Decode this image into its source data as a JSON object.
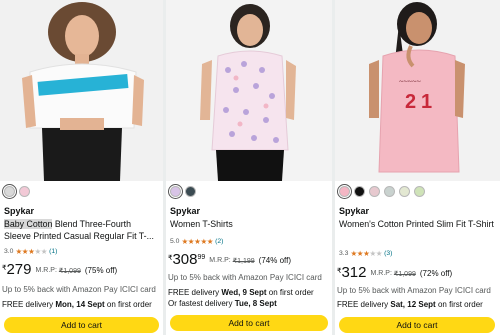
{
  "products": [
    {
      "swatches": [
        "#d9d9d9",
        "#f2c9d6"
      ],
      "brand": "Spykar",
      "title_highlight": "Baby Cotton",
      "title_rest": " Blend Three-Fourth Sleeve Printed Casual Regular Fit T-...",
      "rating_value": "3.0",
      "stars": 3,
      "rating_count": "(1)",
      "currency": "₹",
      "price": "279",
      "price_fraction": "",
      "mrp_label": "M.R.P:",
      "mrp": "₹1,099",
      "discount": "(75% off)",
      "cashback": "Up to 5% back with Amazon Pay ICICI card",
      "delivery_prefix": "FREE delivery ",
      "delivery_date": "Mon, 14 Sept",
      "delivery_suffix": " on first order",
      "fastest_prefix": "",
      "fastest_date": "",
      "cart_label": "Add to cart"
    },
    {
      "swatches": [
        "#d8c4e6",
        "#3b4b52"
      ],
      "brand": "Spykar",
      "title_highlight": "",
      "title_rest": "Women T-Shirts",
      "rating_value": "5.0",
      "stars": 5,
      "rating_count": "(2)",
      "currency": "₹",
      "price": "308",
      "price_fraction": "99",
      "mrp_label": "M.R.P:",
      "mrp": "₹1,199",
      "discount": "(74% off)",
      "cashback": "Up to 5% back with Amazon Pay ICICI card",
      "delivery_prefix": "FREE delivery ",
      "delivery_date": "Wed, 9 Sept",
      "delivery_suffix": " on first order",
      "fastest_prefix": "Or fastest delivery ",
      "fastest_date": "Tue, 8 Sept",
      "cart_label": "Add to cart"
    },
    {
      "swatches": [
        "#f4b6c4",
        "#111111",
        "#e7c9cf",
        "#c9d2cf",
        "#e3e8d2",
        "#cfe3b8"
      ],
      "brand": "Spykar",
      "title_highlight": "",
      "title_rest": "Women's Cotton Printed Slim Fit T-Shirt",
      "rating_value": "3.3",
      "stars": 3,
      "rating_count": "(3)",
      "currency": "₹",
      "price": "312",
      "price_fraction": "",
      "mrp_label": "M.R.P:",
      "mrp": "₹1,099",
      "discount": "(72% off)",
      "cashback": "Up to 5% back with Amazon Pay ICICI card",
      "delivery_prefix": "FREE delivery ",
      "delivery_date": "Sat, 12 Sept",
      "delivery_suffix": " on first order",
      "fastest_prefix": "",
      "fastest_date": "",
      "cart_label": "Add to cart"
    }
  ]
}
